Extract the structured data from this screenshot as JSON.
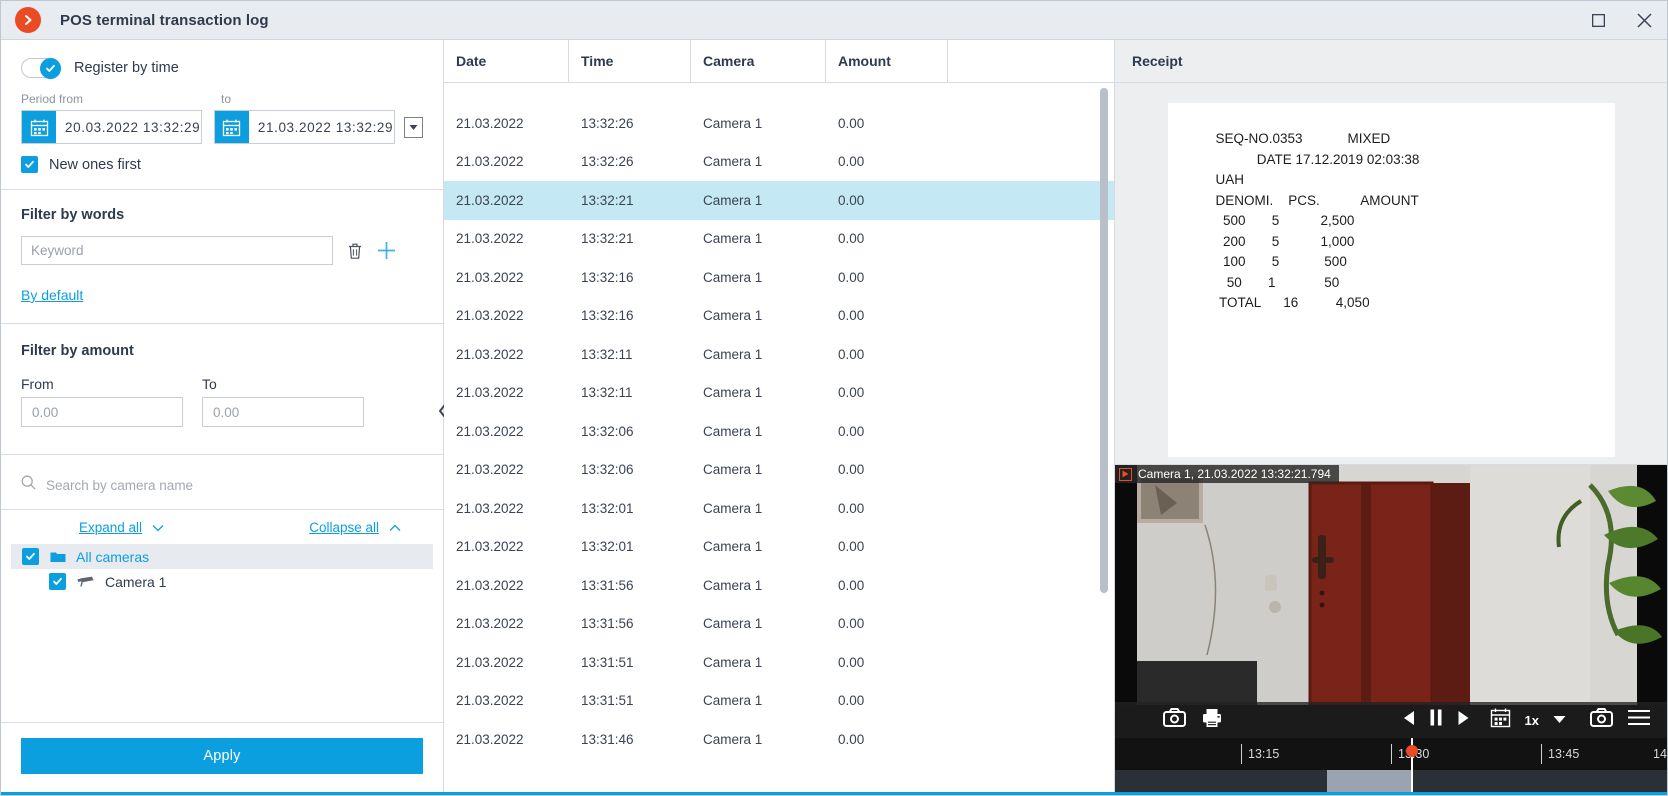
{
  "window": {
    "title": "POS terminal transaction log",
    "logo_icon": "orange-arrow-logo",
    "maximize_icon": "maximize-icon",
    "close_icon": "close-icon"
  },
  "filters": {
    "register_by_time": {
      "label": "Register by time",
      "enabled": true
    },
    "period": {
      "from_label": "Period from",
      "to_label": "to",
      "from_value": "20.03.2022  13:32:29",
      "to_value": "21.03.2022  13:32:29",
      "calendar_icon": "calendar-icon",
      "dropdown_icon": "chevron-down-icon"
    },
    "new_ones_first": {
      "label": "New ones first",
      "checked": true
    },
    "filter_by_words": {
      "title": "Filter by words",
      "keyword_placeholder": "Keyword",
      "keyword_value": "",
      "delete_icon": "trash-icon",
      "add_icon": "plus-icon",
      "by_default_link": "By default"
    },
    "filter_by_amount": {
      "title": "Filter by amount",
      "from_label": "From",
      "to_label": "To",
      "from_placeholder": "0.00",
      "to_placeholder": "0.00",
      "from_value": "",
      "to_value": ""
    },
    "camera_search": {
      "placeholder": "Search by camera name",
      "value": "",
      "search_icon": "search-icon"
    },
    "tree_actions": {
      "expand_all": "Expand all",
      "collapse_all": "Collapse all",
      "expand_icon": "chevron-down-icon",
      "collapse_icon": "chevron-up-icon"
    },
    "camera_tree": [
      {
        "label": "All cameras",
        "icon": "folder-icon",
        "checked": true,
        "selected": true,
        "level": 0
      },
      {
        "label": "Camera 1",
        "icon": "camera-icon",
        "checked": true,
        "selected": false,
        "level": 1
      }
    ],
    "apply_button": "Apply",
    "collapse_panel_icon": "chevron-left-icon"
  },
  "table": {
    "columns": [
      "Date",
      "Time",
      "Camera",
      "Amount"
    ],
    "rows": [
      {
        "date": "21.03.2022",
        "time": "13:32:26",
        "camera": "Camera 1",
        "amount": "0.00",
        "selected": false
      },
      {
        "date": "21.03.2022",
        "time": "13:32:26",
        "camera": "Camera 1",
        "amount": "0.00",
        "selected": false
      },
      {
        "date": "21.03.2022",
        "time": "13:32:21",
        "camera": "Camera 1",
        "amount": "0.00",
        "selected": true
      },
      {
        "date": "21.03.2022",
        "time": "13:32:21",
        "camera": "Camera 1",
        "amount": "0.00",
        "selected": false
      },
      {
        "date": "21.03.2022",
        "time": "13:32:16",
        "camera": "Camera 1",
        "amount": "0.00",
        "selected": false
      },
      {
        "date": "21.03.2022",
        "time": "13:32:16",
        "camera": "Camera 1",
        "amount": "0.00",
        "selected": false
      },
      {
        "date": "21.03.2022",
        "time": "13:32:11",
        "camera": "Camera 1",
        "amount": "0.00",
        "selected": false
      },
      {
        "date": "21.03.2022",
        "time": "13:32:11",
        "camera": "Camera 1",
        "amount": "0.00",
        "selected": false
      },
      {
        "date": "21.03.2022",
        "time": "13:32:06",
        "camera": "Camera 1",
        "amount": "0.00",
        "selected": false
      },
      {
        "date": "21.03.2022",
        "time": "13:32:06",
        "camera": "Camera 1",
        "amount": "0.00",
        "selected": false
      },
      {
        "date": "21.03.2022",
        "time": "13:32:01",
        "camera": "Camera 1",
        "amount": "0.00",
        "selected": false
      },
      {
        "date": "21.03.2022",
        "time": "13:32:01",
        "camera": "Camera 1",
        "amount": "0.00",
        "selected": false
      },
      {
        "date": "21.03.2022",
        "time": "13:31:56",
        "camera": "Camera 1",
        "amount": "0.00",
        "selected": false
      },
      {
        "date": "21.03.2022",
        "time": "13:31:56",
        "camera": "Camera 1",
        "amount": "0.00",
        "selected": false
      },
      {
        "date": "21.03.2022",
        "time": "13:31:51",
        "camera": "Camera 1",
        "amount": "0.00",
        "selected": false
      },
      {
        "date": "21.03.2022",
        "time": "13:31:51",
        "camera": "Camera 1",
        "amount": "0.00",
        "selected": false
      },
      {
        "date": "21.03.2022",
        "time": "13:31:46",
        "camera": "Camera 1",
        "amount": "0.00",
        "selected": false
      }
    ]
  },
  "receipt": {
    "panel_title": "Receipt",
    "lines": [
      "SEQ-NO.0353            MIXED",
      "           DATE 17.12.2019 02:03:38",
      "UAH",
      "DENOMI.    PCS.           AMOUNT",
      "  500       5           2,500",
      "  200       5           1,000",
      "  100       5            500",
      "   50       1             50",
      " TOTAL      16          4,050"
    ]
  },
  "player": {
    "camera_label": "Camera 1, 21.03.2022 13:32:21.794",
    "record_icon": "record-play-icon",
    "snapshot_icon": "camera-snapshot-icon",
    "print_icon": "printer-icon",
    "prev_icon": "step-back-icon",
    "pause_icon": "pause-icon",
    "play_icon": "play-icon",
    "calendar_icon": "calendar-icon",
    "speed": "1x",
    "speed_dropdown_icon": "chevron-down-icon",
    "screenshot_icon": "screenshot-icon",
    "menu_icon": "hamburger-menu-icon",
    "timeline_labels": [
      "13:15",
      "13:30",
      "13:45"
    ],
    "timeline_end_label": "14:"
  }
}
